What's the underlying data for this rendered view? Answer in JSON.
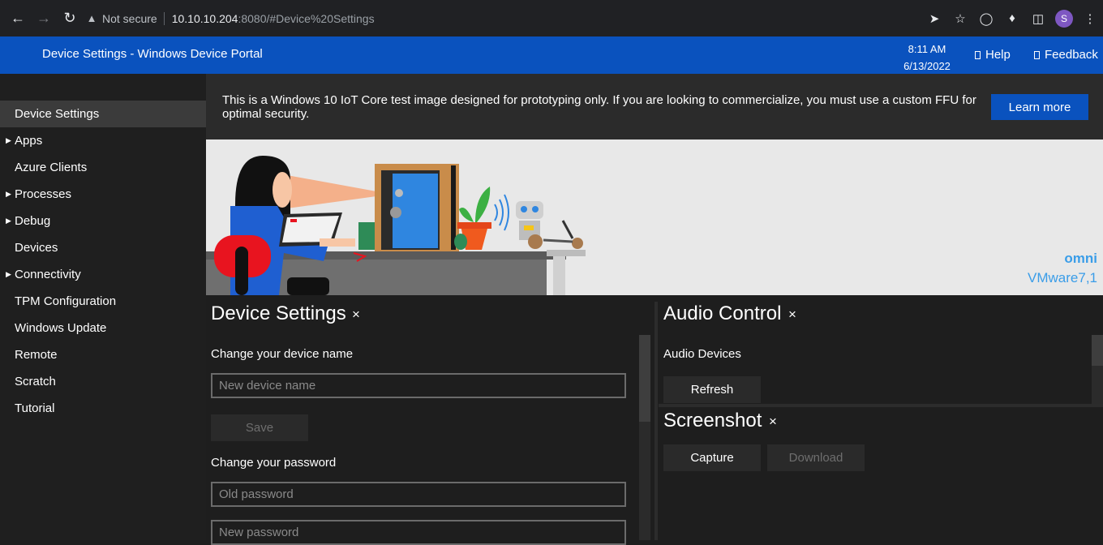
{
  "browser": {
    "security_label": "Not secure",
    "url_host": "10.10.10.204",
    "url_rest": ":8080/#Device%20Settings",
    "profile_initial": "S"
  },
  "header": {
    "title": "Device Settings - Windows Device Portal",
    "time": "8:11 AM",
    "date": "6/13/2022",
    "help": "Help",
    "feedback": "Feedback"
  },
  "sidebar": {
    "items": [
      {
        "label": "Device Settings",
        "expandable": false,
        "active": true
      },
      {
        "label": "Apps",
        "expandable": true
      },
      {
        "label": "Azure Clients",
        "expandable": false
      },
      {
        "label": "Processes",
        "expandable": true
      },
      {
        "label": "Debug",
        "expandable": true
      },
      {
        "label": "Devices",
        "expandable": false
      },
      {
        "label": "Connectivity",
        "expandable": true
      },
      {
        "label": "TPM Configuration",
        "expandable": false
      },
      {
        "label": "Windows Update",
        "expandable": false
      },
      {
        "label": "Remote",
        "expandable": false
      },
      {
        "label": "Scratch",
        "expandable": false
      },
      {
        "label": "Tutorial",
        "expandable": false
      }
    ]
  },
  "notice": {
    "text": "This is a Windows 10 IoT Core test image designed for prototyping only. If you are looking to commercialize, you must use a custom FFU for optimal security.",
    "button": "Learn more"
  },
  "hero": {
    "device_name": "omni",
    "device_model": "VMware7,1"
  },
  "device_settings": {
    "title": "Device Settings",
    "close": "×",
    "name_label": "Change your device name",
    "name_placeholder": "New device name",
    "save": "Save",
    "password_label": "Change your password",
    "old_password_placeholder": "Old password",
    "new_password_placeholder": "New password"
  },
  "audio": {
    "title": "Audio Control",
    "close": "×",
    "devices_label": "Audio Devices",
    "refresh": "Refresh"
  },
  "screenshot": {
    "title": "Screenshot",
    "close": "×",
    "capture": "Capture",
    "download": "Download"
  },
  "colors": {
    "brand_blue": "#0a52be",
    "accent_text": "#3a9de8"
  }
}
